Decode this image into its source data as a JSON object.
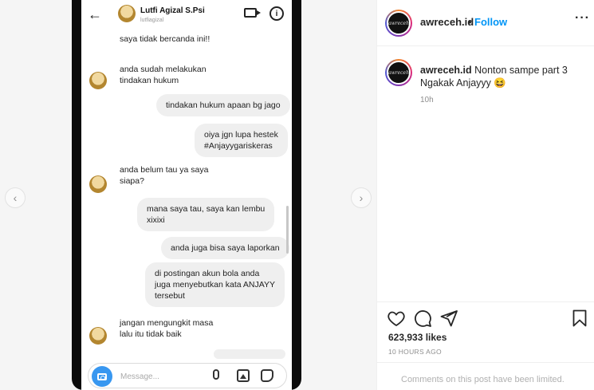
{
  "dm": {
    "contact_name": "Lutfi Agizal S.Psi",
    "contact_handle": "lutfiagizal",
    "composer_placeholder": "Message...",
    "messages": [
      {
        "side": "in",
        "text": "saya tidak bercanda ini!!"
      },
      {
        "side": "in",
        "text": "anda sudah melakukan\ntindakan hukum"
      },
      {
        "side": "out",
        "text": "tindakan hukum apaan bg jago"
      },
      {
        "side": "out",
        "text": "oiya jgn lupa hestek\n#Anjayygariskeras"
      },
      {
        "side": "in",
        "text": "anda belum tau ya saya\nsiapa?"
      },
      {
        "side": "out",
        "text": "mana saya tau, saya kan lembu\nxixixi"
      },
      {
        "side": "out",
        "text": "anda juga bisa saya laporkan"
      },
      {
        "side": "out",
        "text": "di postingan akun bola anda\njuga menyebutkan kata ANJAYY\ntersebut"
      },
      {
        "side": "in",
        "text": "jangan mengungkit masa\nlalu itu tidak baik"
      }
    ]
  },
  "post": {
    "username": "awreceh.id",
    "follow_label": "Follow",
    "separator": "•",
    "avatar_text": "awreceh",
    "caption": "Nonton sampe part 3 Ngakak Anjayyy 😆",
    "comment_time": "10h",
    "likes": "623,933 likes",
    "posted_ago": "10 HOURS AGO",
    "comments_disabled": "Comments on this post have been limited."
  },
  "icons": [
    "back-arrow-icon",
    "video-call-icon",
    "info-icon",
    "camera-icon",
    "microphone-icon",
    "gallery-icon",
    "sticker-icon",
    "heart-icon",
    "comment-icon",
    "share-icon",
    "bookmark-icon",
    "more-icon",
    "chevron-left-icon",
    "chevron-right-icon"
  ],
  "colors": {
    "accent": "#0095f6",
    "camera": "#3897f0",
    "bubble": "#efefef"
  }
}
